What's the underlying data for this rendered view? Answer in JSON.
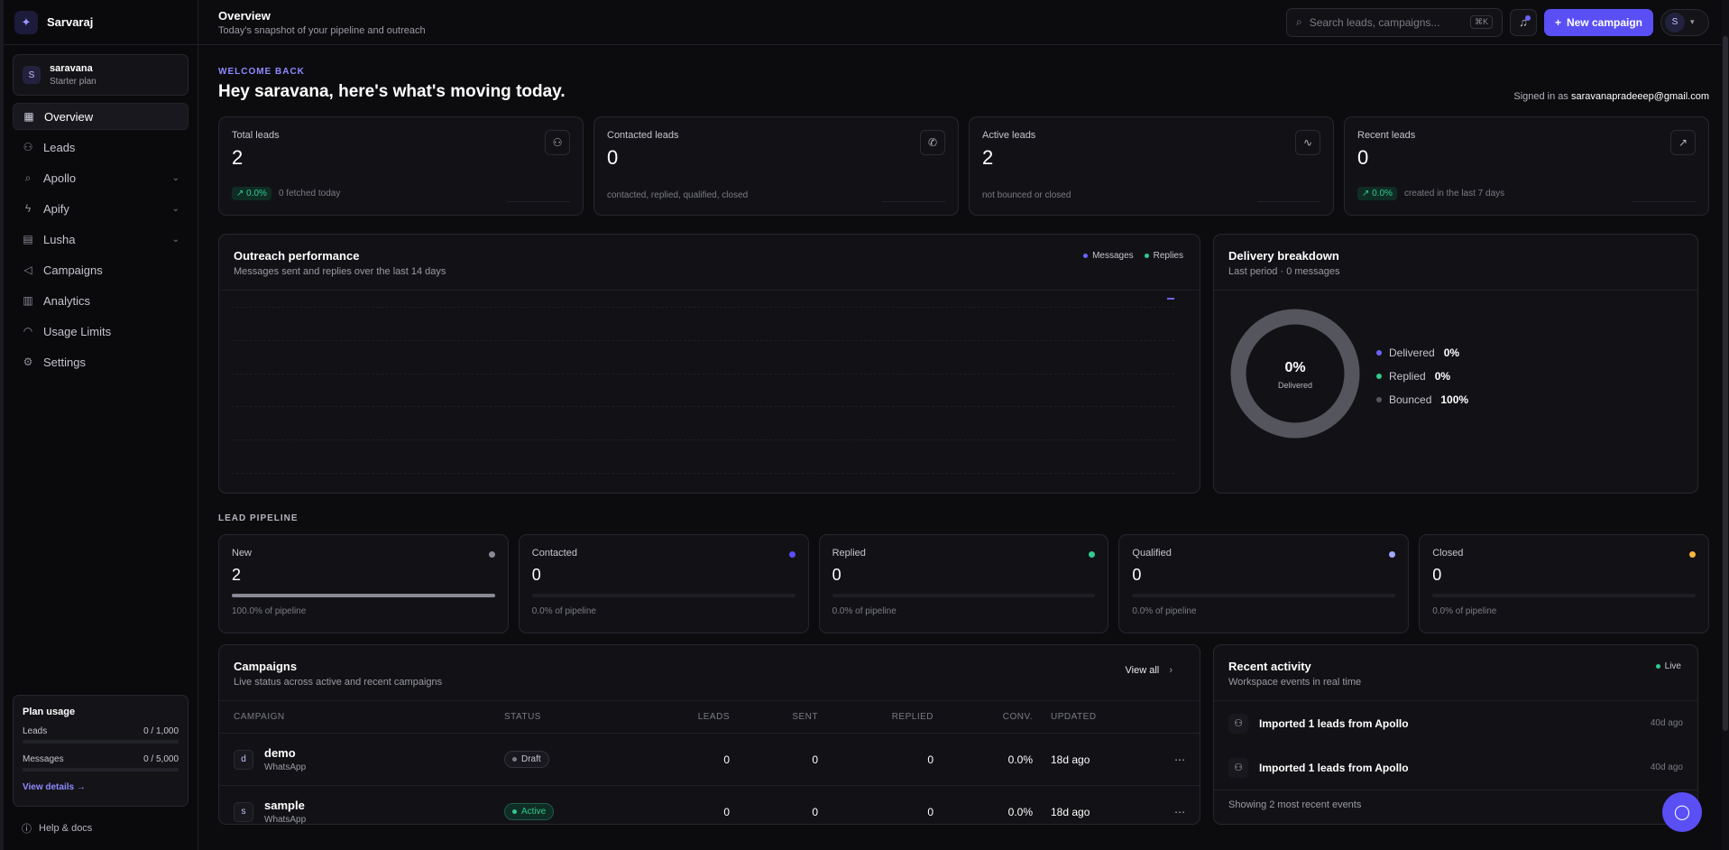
{
  "brand": {
    "name": "Sarvaraj"
  },
  "account": {
    "avatar": "S",
    "name": "saravana",
    "plan": "Starter plan"
  },
  "nav": [
    {
      "label": "Overview",
      "icon": "grid-icon",
      "glyph": "▦",
      "active": true,
      "expandable": false
    },
    {
      "label": "Leads",
      "icon": "users-icon",
      "glyph": "⚇",
      "active": false,
      "expandable": false
    },
    {
      "label": "Apollo",
      "icon": "search-icon",
      "glyph": "⌕",
      "active": false,
      "expandable": true
    },
    {
      "label": "Apify",
      "icon": "bolt-icon",
      "glyph": "ϟ",
      "active": false,
      "expandable": true
    },
    {
      "label": "Lusha",
      "icon": "database-icon",
      "glyph": "▤",
      "active": false,
      "expandable": true
    },
    {
      "label": "Campaigns",
      "icon": "megaphone-icon",
      "glyph": "◁",
      "active": false,
      "expandable": false
    },
    {
      "label": "Analytics",
      "icon": "bar-chart-icon",
      "glyph": "▥",
      "active": false,
      "expandable": false
    },
    {
      "label": "Usage Limits",
      "icon": "gauge-icon",
      "glyph": "◠",
      "active": false,
      "expandable": false
    },
    {
      "label": "Settings",
      "icon": "gear-icon",
      "glyph": "⚙",
      "active": false,
      "expandable": false
    }
  ],
  "plan_usage": {
    "title": "Plan usage",
    "leads_label": "Leads",
    "leads_value": "0 / 1,000",
    "messages_label": "Messages",
    "messages_value": "0 / 5,000",
    "link": "View details →"
  },
  "help": "Help & docs",
  "topbar": {
    "title": "Overview",
    "subtitle": "Today's snapshot of your pipeline and outreach",
    "search_placeholder": "Search leads, campaigns...",
    "search_kbd": "⌘K",
    "new_button": "New campaign",
    "user_avatar": "S"
  },
  "welcome": {
    "eyebrow": "WELCOME BACK",
    "title": "Hey saravana, here's what's moving today.",
    "signed_prefix": "Signed in as",
    "email": "saravanapradeeep@gmail.com"
  },
  "stats": [
    {
      "label": "Total leads",
      "value": "2",
      "badge": "↗ 0.0%",
      "foot": "0 fetched today",
      "icon": "users-icon",
      "glyph": "⚇"
    },
    {
      "label": "Contacted leads",
      "value": "0",
      "badge": "",
      "foot": "contacted, replied, qualified, closed",
      "icon": "phone-icon",
      "glyph": "✆"
    },
    {
      "label": "Active leads",
      "value": "2",
      "badge": "",
      "foot": "not bounced or closed",
      "icon": "activity-icon",
      "glyph": "∿"
    },
    {
      "label": "Recent leads",
      "value": "0",
      "badge": "↗ 0.0%",
      "foot": "created in the last 7 days",
      "icon": "trending-up-icon",
      "glyph": "↗"
    }
  ],
  "outreach": {
    "title": "Outreach performance",
    "subtitle": "Messages sent and replies over the last 14 days",
    "legend": [
      {
        "name": "Messages",
        "color": "#6b63ff"
      },
      {
        "name": "Replies",
        "color": "#31c98e"
      }
    ]
  },
  "delivery": {
    "title": "Delivery breakdown",
    "subtitle": "Last period · 0 messages",
    "center_value": "0%",
    "center_label": "Delivered",
    "items": [
      {
        "label": "Delivered",
        "value": "0%",
        "fraction": 0,
        "color": "#6b63ff"
      },
      {
        "label": "Replied",
        "value": "0%",
        "fraction": 0,
        "color": "#31c98e"
      },
      {
        "label": "Bounced",
        "value": "100%",
        "fraction": 1,
        "color": "#55555e"
      }
    ]
  },
  "pipeline": {
    "label": "LEAD PIPELINE",
    "stages": [
      {
        "label": "New",
        "value": "2",
        "foot": "100.0% of pipeline",
        "fraction": 1.0,
        "color": "#8a8a96"
      },
      {
        "label": "Contacted",
        "value": "0",
        "foot": "0.0% of pipeline",
        "fraction": 0,
        "color": "#5a4ff5"
      },
      {
        "label": "Replied",
        "value": "0",
        "foot": "0.0% of pipeline",
        "fraction": 0,
        "color": "#31c98e"
      },
      {
        "label": "Qualified",
        "value": "0",
        "foot": "0.0% of pipeline",
        "fraction": 0,
        "color": "#a3a8ff"
      },
      {
        "label": "Closed",
        "value": "0",
        "foot": "0.0% of pipeline",
        "fraction": 0,
        "color": "#f4b63f"
      }
    ]
  },
  "campaigns": {
    "title": "Campaigns",
    "subtitle": "Live status across active and recent campaigns",
    "view_all": "View all",
    "columns": [
      "CAMPAIGN",
      "STATUS",
      "LEADS",
      "SENT",
      "REPLIED",
      "CONV.",
      "UPDATED"
    ],
    "rows": [
      {
        "avatar": "d",
        "name": "demo",
        "channel": "WhatsApp",
        "status": "Draft",
        "leads": "0",
        "sent": "0",
        "replied": "0",
        "conv": "0.0%",
        "updated": "18d ago"
      },
      {
        "avatar": "s",
        "name": "sample",
        "channel": "WhatsApp",
        "status": "Active",
        "leads": "0",
        "sent": "0",
        "replied": "0",
        "conv": "0.0%",
        "updated": "18d ago"
      }
    ]
  },
  "activity": {
    "title": "Recent activity",
    "subtitle": "Workspace events in real time",
    "live": "Live",
    "items": [
      {
        "text": "Imported 1 leads from Apollo",
        "time": "40d ago"
      },
      {
        "text": "Imported 1 leads from Apollo",
        "time": "40d ago"
      }
    ],
    "footer": "Showing 2 most recent events"
  }
}
